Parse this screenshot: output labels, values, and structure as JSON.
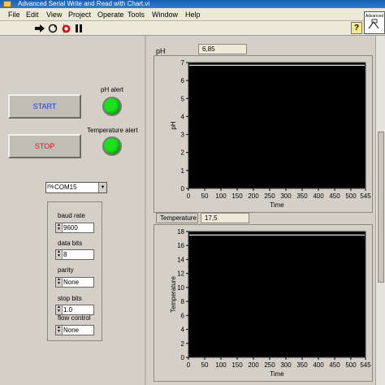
{
  "window": {
    "title": "Advanced Serial Write and Read with Chart.vi"
  },
  "menu": [
    "File",
    "Edit",
    "View",
    "Project",
    "Operate",
    "Tools",
    "Window",
    "Help"
  ],
  "toolbar": {
    "help_label": "?",
    "badge_label": "Advanced"
  },
  "controls": {
    "start_label": "START",
    "stop_label": "STOP",
    "ph_alert_label": "pH alert",
    "temp_alert_label": "Temperature alert",
    "led_color": "#1ce01c",
    "port": "COM15"
  },
  "serial": {
    "baud_rate_label": "baud rate",
    "baud_rate": "9600",
    "data_bits_label": "data bits",
    "data_bits": "8",
    "parity_label": "parity",
    "parity": "None",
    "stop_bits_label": "stop bits",
    "stop_bits": "1.0",
    "flow_control_label": "flow control",
    "flow_control": "None"
  },
  "ph_chart": {
    "label": "pH",
    "readout": "6,85",
    "ylabel": "pH",
    "xlabel": "Time",
    "yticks": [
      "0",
      "1",
      "2",
      "3",
      "4",
      "5",
      "6",
      "7"
    ],
    "xticks": [
      "0",
      "50",
      "100",
      "150",
      "200",
      "250",
      "300",
      "350",
      "400",
      "450",
      "500",
      "545"
    ],
    "xlim": [
      0,
      545
    ],
    "ylim": [
      0,
      7
    ],
    "trace_level": 6.85
  },
  "temp_chart": {
    "label": "Temperature",
    "readout": "17,5",
    "ylabel": "Temperature",
    "xlabel": "Time",
    "yticks": [
      "0",
      "2",
      "4",
      "6",
      "8",
      "10",
      "12",
      "14",
      "16",
      "18"
    ],
    "xticks": [
      "0",
      "50",
      "100",
      "150",
      "200",
      "250",
      "300",
      "350",
      "400",
      "450",
      "500",
      "545"
    ],
    "xlim": [
      0,
      545
    ],
    "ylim": [
      0,
      18
    ],
    "trace_level": 17.5
  }
}
